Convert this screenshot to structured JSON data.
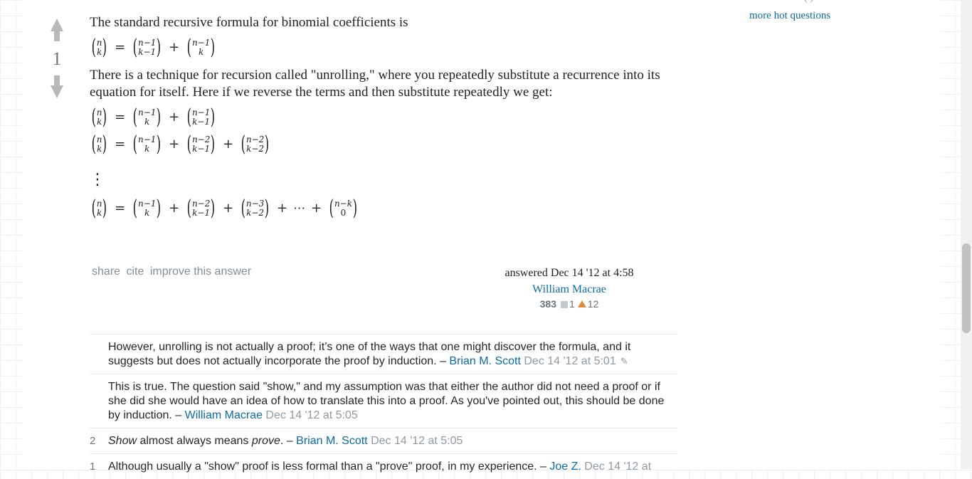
{
  "sidebar": {
    "more_hot_questions": "more hot questions"
  },
  "answer": {
    "score": "1",
    "p1": "The standard recursive formula for binomial coefficients is",
    "p2": "There is a technique for recursion called \"unrolling,\" where you repeatedly substitute a recurrence into its equation for itself. Here if we reverse the terms and then substitute repeatedly we get:",
    "math": {
      "n": "n",
      "k": "k",
      "nm1": "n−1",
      "km1": "k−1",
      "nm2": "n−2",
      "km2": "k−2",
      "nm3": "n−3",
      "nmk": "n−k",
      "zero": "0",
      "eq": "=",
      "plus": "+",
      "cdots": "⋯",
      "vdots": "⋮"
    },
    "menu": {
      "share": "share",
      "cite": "cite",
      "improve": "improve this answer"
    },
    "answered": "answered Dec 14 '12 at 4:58",
    "user": "William Macrae",
    "rep": "383",
    "silver": "1",
    "bronze": "12"
  },
  "comments": [
    {
      "votes": "",
      "text": "However, unrolling is not actually a proof; it’s one of the ways that one might discover the formula, and it suggests but does not actually incorporate the proof by induction. – ",
      "author": "Brian M. Scott",
      "time": "Dec 14 '12 at 5:01"
    },
    {
      "votes": "",
      "text": "This is true. The question said \"show,\" and my assumption was that either the author did not need a proof or if she did she would have an idea of how to translate this into a proof. As you've pointed out, this should be done by induction. – ",
      "author": "William Macrae",
      "time": "Dec 14 '12 at 5:05"
    },
    {
      "votes": "2",
      "text_em1": "Show",
      "text_mid": " almost always means ",
      "text_em2": "prove",
      "text_end": ". – ",
      "author": "Brian M. Scott",
      "time": "Dec 14 '12 at 5:05"
    },
    {
      "votes": "1",
      "text": "Although usually a \"show\" proof is less formal than a \"prove\" proof, in my experience. – ",
      "author": "Joe Z.",
      "time": "Dec 14 '12 at"
    }
  ]
}
